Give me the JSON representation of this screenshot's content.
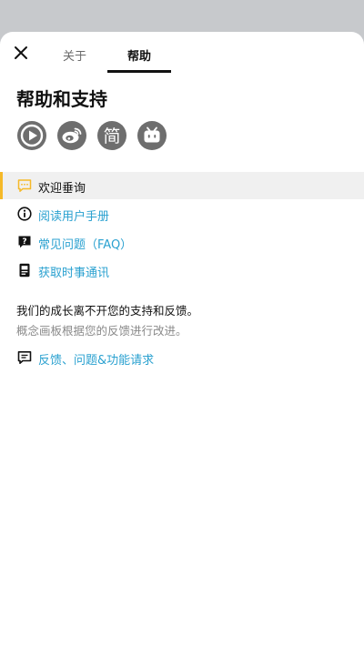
{
  "tabs": [
    {
      "label": "关于",
      "active": false
    },
    {
      "label": "帮助",
      "active": true
    }
  ],
  "page_title": "帮助和支持",
  "social_icons": [
    "play-circle-icon",
    "weibo-icon",
    "jian-icon",
    "bilibili-icon"
  ],
  "social_jian_glyph": "简",
  "menu": {
    "items": [
      {
        "label": "欢迎垂询",
        "icon": "chat-bubble-icon",
        "active": true
      },
      {
        "label": "阅读用户手册",
        "icon": "info-circle-icon"
      },
      {
        "label": "常见问题（FAQ）",
        "icon": "question-bubble-icon"
      },
      {
        "label": "获取时事通讯",
        "icon": "newsletter-icon"
      }
    ]
  },
  "note": {
    "title": "我们的成长离不开您的支持和反馈。",
    "subtitle": "概念画板根据您的反馈进行改进。"
  },
  "feedback": {
    "label": "反馈、问题&功能请求",
    "icon": "comment-icon"
  },
  "colors": {
    "accent": "#f5b928",
    "link": "#2aa1d0",
    "icon_gray": "#6e6e6e",
    "backdrop": "#c7c9cc"
  }
}
